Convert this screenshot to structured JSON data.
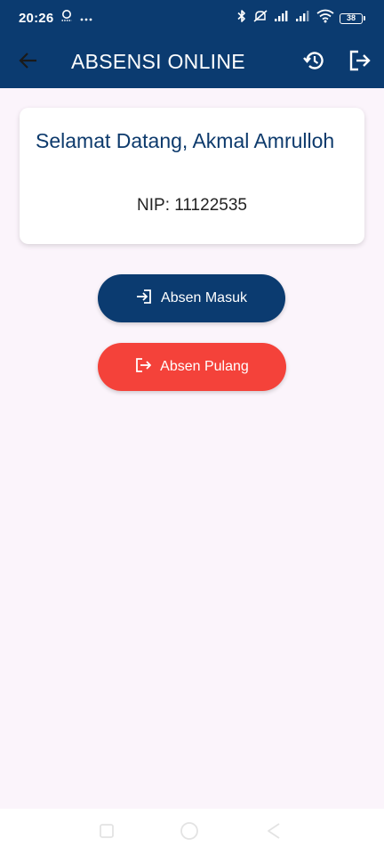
{
  "status_bar": {
    "time": "20:26",
    "battery": "38",
    "icons": [
      "user-icon",
      "more-icon",
      "bluetooth-icon",
      "mute-icon",
      "signal-icon",
      "signal-icon",
      "wifi-icon",
      "battery-icon"
    ]
  },
  "app_bar": {
    "title": "ABSENSI ONLINE",
    "icons": [
      "back-arrow-icon",
      "history-icon",
      "logout-icon"
    ]
  },
  "card": {
    "welcome": "Selamat Datang, Akmal Amrulloh",
    "nip": "NIP: 11122535"
  },
  "actions": {
    "masuk_label": "Absen Masuk",
    "pulang_label": "Absen Pulang"
  },
  "colors": {
    "primary": "#0b3b70",
    "danger": "#f4423a",
    "background": "#fbf4fb"
  },
  "nav": {
    "icons": [
      "recents-icon",
      "home-icon",
      "back-icon"
    ]
  }
}
